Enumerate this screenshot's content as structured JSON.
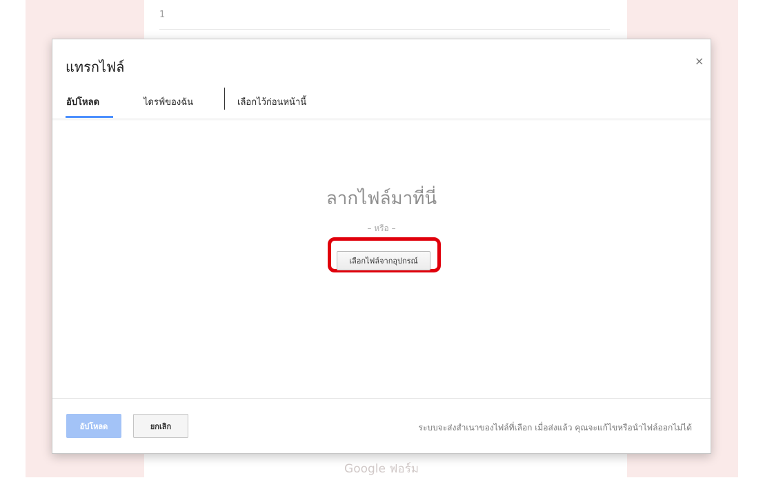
{
  "background": {
    "question_number": "1",
    "footer_brand": "Google ฟอร์ม"
  },
  "dialog": {
    "title": "แทรกไฟล์",
    "close_icon": "×",
    "tabs": [
      {
        "label": "อัปโหลด",
        "active": true
      },
      {
        "label": "ไดรฟ์ของฉัน",
        "active": false
      },
      {
        "label": "เลือกไว้ก่อนหน้านี้",
        "active": false
      }
    ],
    "drop_zone": {
      "heading": "ลากไฟล์มาที่นี่",
      "or_label": "– หรือ –",
      "select_button": "เลือกไฟล์จากอุปกรณ์"
    },
    "footer": {
      "upload_button": "อัปโหลด",
      "cancel_button": "ยกเลิก",
      "note": "ระบบจะส่งสำเนาของไฟล์ที่เลือก เมื่อส่งแล้ว คุณจะแก้ไขหรือนำไฟล์ออกไม่ได้"
    }
  },
  "colors": {
    "accent": "#4d90fe",
    "upload_button_disabled": "#a3c3f7",
    "highlight": "#e0000b",
    "page_background": "#faeae9"
  }
}
